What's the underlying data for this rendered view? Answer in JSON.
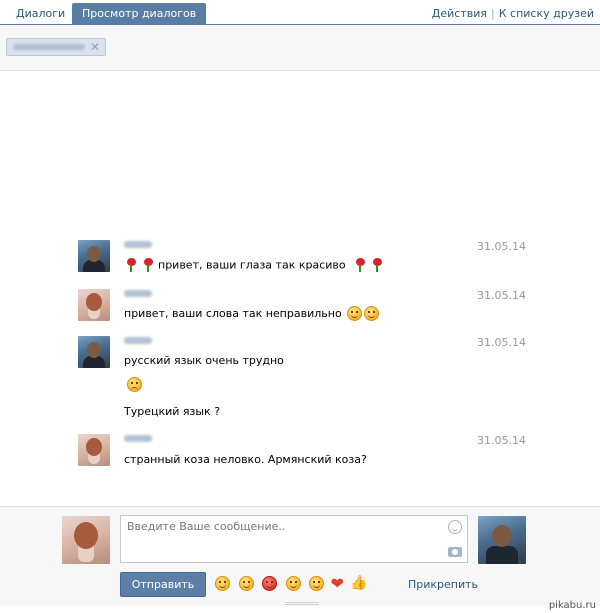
{
  "tabs": [
    {
      "label": "Диалоги"
    },
    {
      "label": "Просмотр диалогов"
    }
  ],
  "top_links": {
    "actions": "Действия",
    "separator": "|",
    "friends_list": "К списку друзей"
  },
  "messages": [
    {
      "date": "31.05.14",
      "lines": [
        "привет, ваши глаза так красиво"
      ]
    },
    {
      "date": "31.05.14",
      "lines": [
        "привет, ваши слова так неправильно"
      ]
    },
    {
      "date": "31.05.14",
      "lines": [
        "русский язык очень трудно",
        "Турецкий язык ?"
      ]
    },
    {
      "date": "31.05.14",
      "lines": [
        "странный коза неловко. Армянский коза?"
      ]
    }
  ],
  "composer": {
    "placeholder": "Введите Ваше сообщение..",
    "send_label": "Отправить",
    "attach_label": "Прикрепить"
  },
  "watermark": "pikabu.ru"
}
